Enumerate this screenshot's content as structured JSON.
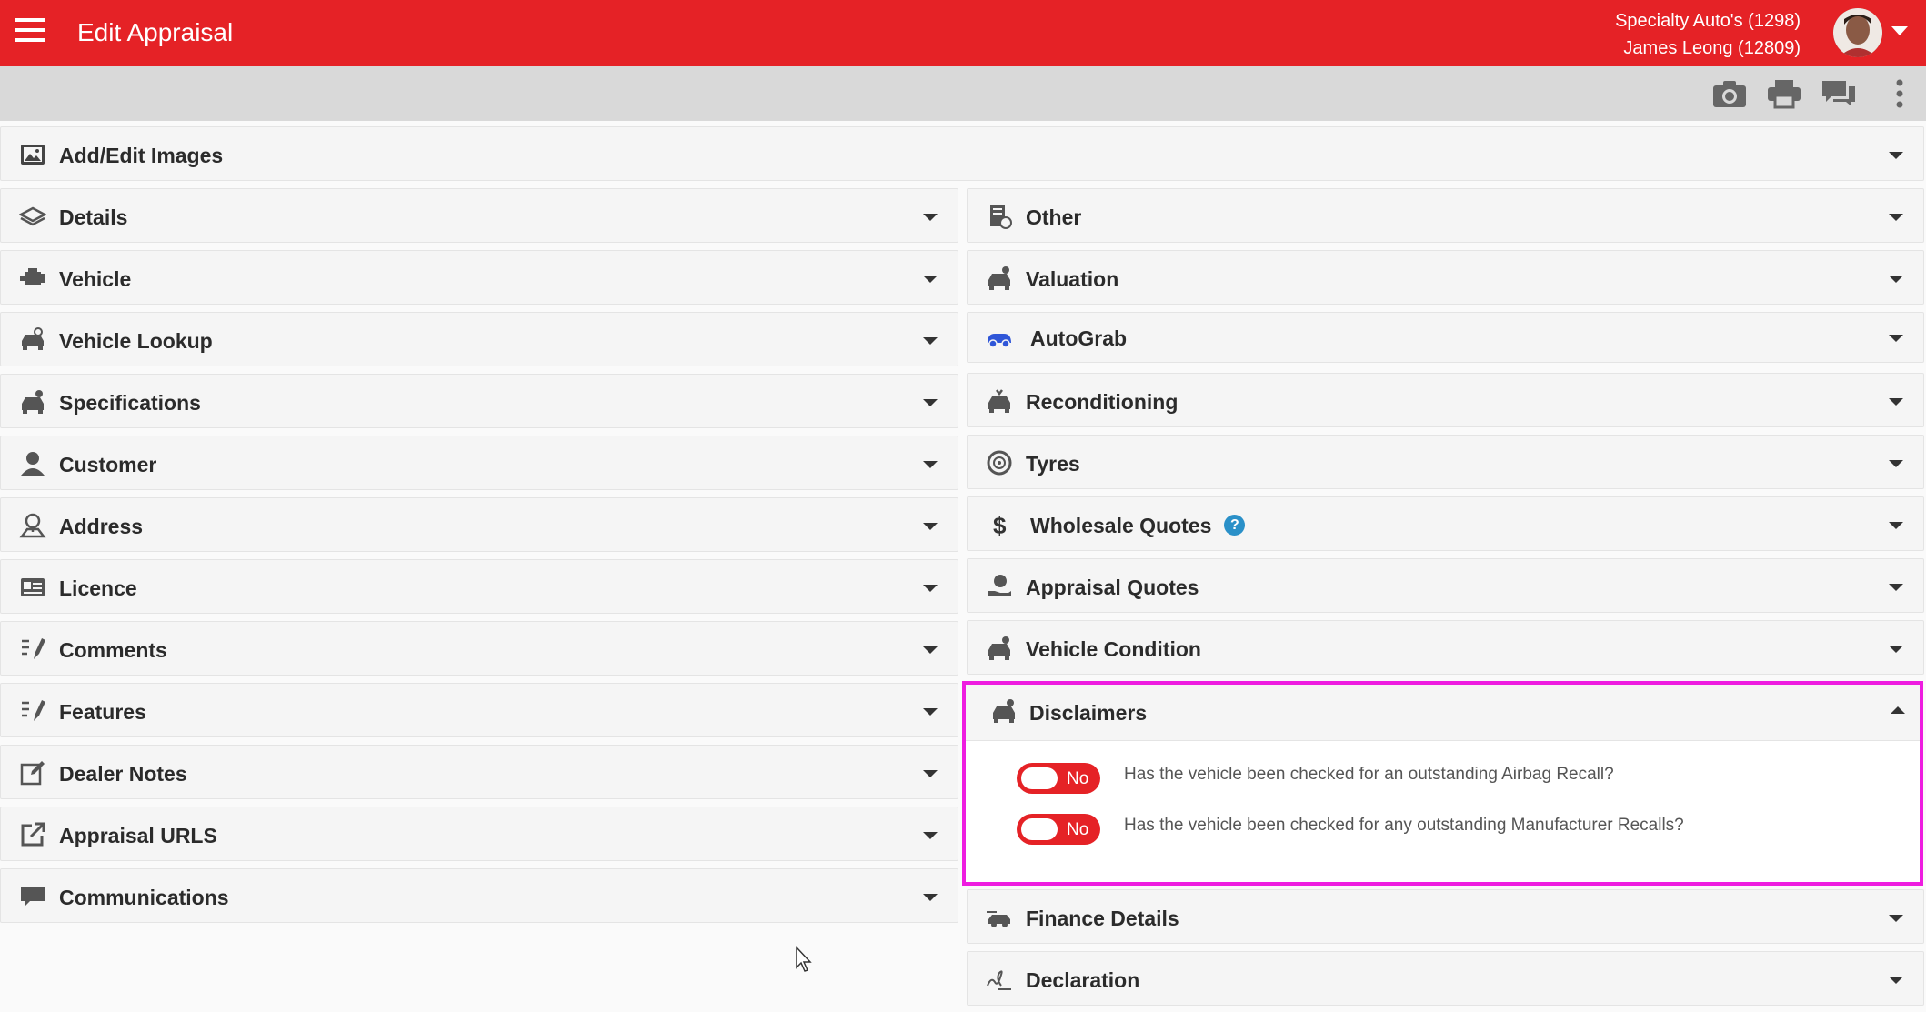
{
  "header": {
    "title": "Edit Appraisal",
    "dealer": "Specialty Auto's (1298)",
    "user": "James Leong (12809)",
    "brand_color": "#e52226"
  },
  "toolbar": {
    "icons": [
      "camera-icon",
      "printer-icon",
      "chat-icon",
      "more-vertical-icon"
    ]
  },
  "top_panel": {
    "label": "Add/Edit Images",
    "icon": "image-icon"
  },
  "left_panels": [
    {
      "label": "Details",
      "icon": "layers-icon"
    },
    {
      "label": "Vehicle",
      "icon": "engine-icon"
    },
    {
      "label": "Vehicle Lookup",
      "icon": "car-search-icon"
    },
    {
      "label": "Specifications",
      "icon": "car-settings-icon"
    },
    {
      "label": "Customer",
      "icon": "person-icon"
    },
    {
      "label": "Address",
      "icon": "location-icon"
    },
    {
      "label": "Licence",
      "icon": "id-card-icon"
    },
    {
      "label": "Comments",
      "icon": "checklist-edit-icon"
    },
    {
      "label": "Features",
      "icon": "checklist-edit-icon"
    },
    {
      "label": "Dealer Notes",
      "icon": "note-edit-icon"
    },
    {
      "label": "Appraisal URLS",
      "icon": "external-link-icon"
    },
    {
      "label": "Communications",
      "icon": "chat-icon"
    }
  ],
  "right_panels": [
    {
      "label": "Other",
      "icon": "document-clock-icon"
    },
    {
      "label": "Valuation",
      "icon": "car-dollar-icon"
    },
    {
      "label": "AutoGrab",
      "icon": "autograb-logo-icon"
    },
    {
      "label": "Reconditioning",
      "icon": "car-wrench-icon"
    },
    {
      "label": "Tyres",
      "icon": "tyre-icon"
    },
    {
      "label": "Wholesale Quotes",
      "icon": "dollar-icon",
      "help": "?"
    },
    {
      "label": "Appraisal Quotes",
      "icon": "hand-dollar-icon"
    },
    {
      "label": "Vehicle Condition",
      "icon": "car-check-icon"
    }
  ],
  "disclaimers": {
    "label": "Disclaimers",
    "icon": "car-info-icon",
    "items": [
      {
        "toggle": "No",
        "question": "Has the vehicle been checked for an outstanding Airbag Recall?"
      },
      {
        "toggle": "No",
        "question": "Has the vehicle been checked for any outstanding Manufacturer Recalls?"
      }
    ]
  },
  "bottom_right_panels": [
    {
      "label": "Finance Details",
      "icon": "car-finance-icon"
    },
    {
      "label": "Declaration",
      "icon": "signature-icon"
    }
  ]
}
